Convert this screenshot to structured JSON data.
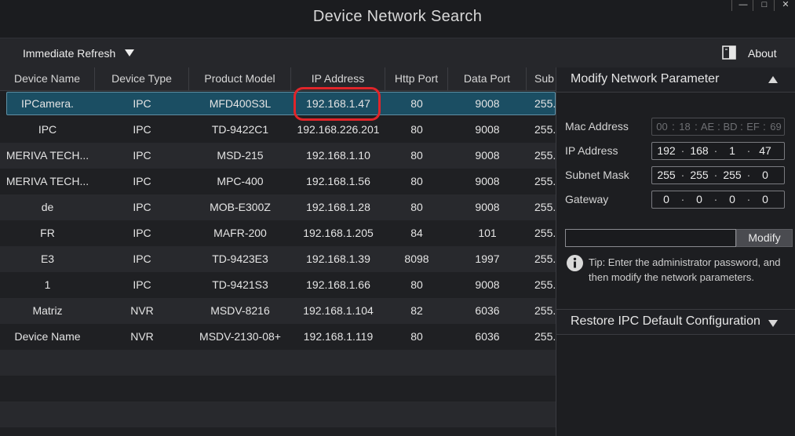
{
  "window": {
    "title": "Device Network Search",
    "minimize_glyph": "—",
    "maximize_glyph": "□",
    "close_glyph": "✕"
  },
  "toolbar": {
    "refresh_label": "Immediate Refresh",
    "about_label": "About"
  },
  "table": {
    "columns": [
      "Device Name",
      "Device Type",
      "Product Model",
      "IP Address",
      "Http Port",
      "Data Port",
      "Sub"
    ],
    "rows": [
      {
        "name": "IPCamera.",
        "type": "IPC",
        "model": "MFD400S3L",
        "ip": "192.168.1.47",
        "http": "80",
        "data": "9008",
        "sub": "255."
      },
      {
        "name": "IPC",
        "type": "IPC",
        "model": "TD-9422C1",
        "ip": "192.168.226.201",
        "http": "80",
        "data": "9008",
        "sub": "255."
      },
      {
        "name": "MERIVA TECH...",
        "type": "IPC",
        "model": "MSD-215",
        "ip": "192.168.1.10",
        "http": "80",
        "data": "9008",
        "sub": "255."
      },
      {
        "name": "MERIVA TECH...",
        "type": "IPC",
        "model": "MPC-400",
        "ip": "192.168.1.56",
        "http": "80",
        "data": "9008",
        "sub": "255."
      },
      {
        "name": "de",
        "type": "IPC",
        "model": "MOB-E300Z",
        "ip": "192.168.1.28",
        "http": "80",
        "data": "9008",
        "sub": "255."
      },
      {
        "name": "FR",
        "type": "IPC",
        "model": "MAFR-200",
        "ip": "192.168.1.205",
        "http": "84",
        "data": "101",
        "sub": "255."
      },
      {
        "name": "E3",
        "type": "IPC",
        "model": "TD-9423E3",
        "ip": "192.168.1.39",
        "http": "8098",
        "data": "1997",
        "sub": "255."
      },
      {
        "name": "1",
        "type": "IPC",
        "model": "TD-9421S3",
        "ip": "192.168.1.66",
        "http": "80",
        "data": "9008",
        "sub": "255."
      },
      {
        "name": "Matriz",
        "type": "NVR",
        "model": "MSDV-8216",
        "ip": "192.168.1.104",
        "http": "82",
        "data": "6036",
        "sub": "255."
      },
      {
        "name": "Device Name",
        "type": "NVR",
        "model": "MSDV-2130-08+",
        "ip": "192.168.1.119",
        "http": "80",
        "data": "6036",
        "sub": "255."
      }
    ],
    "selected_index": 0
  },
  "panel": {
    "modify_title": "Modify Network Parameter",
    "mac_label": "Mac Address",
    "mac": [
      "00",
      "18",
      "AE",
      "BD",
      "EF",
      "69"
    ],
    "ip_label": "IP Address",
    "ip": [
      "192",
      "168",
      "1",
      "47"
    ],
    "mask_label": "Subnet Mask",
    "mask": [
      "255",
      "255",
      "255",
      "0"
    ],
    "gateway_label": "Gateway",
    "gateway": [
      "0",
      "0",
      "0",
      "0"
    ],
    "password_value": "",
    "modify_button": "Modify",
    "tip": "Tip: Enter the administrator password, and then modify the network parameters.",
    "restore_title": "Restore IPC Default Configuration"
  },
  "colors": {
    "selection": "#1b4e63",
    "highlight_ring": "#e0252a"
  }
}
